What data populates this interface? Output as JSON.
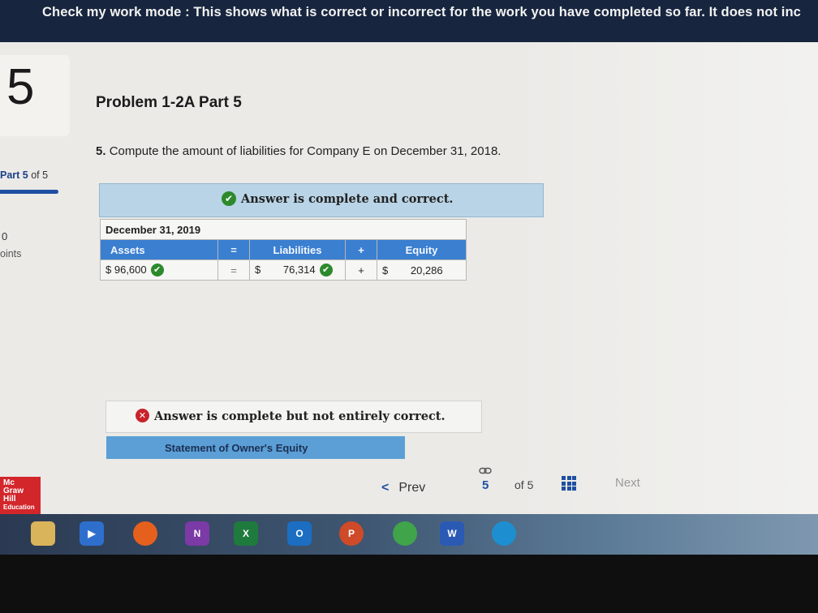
{
  "banner": {
    "text": "Check my work mode : This shows what is correct or incorrect for the work you have completed so far. It does not inc"
  },
  "sidebar": {
    "part_number": "5",
    "part_label": "Part 5",
    "of_label": "of 5",
    "points_value": "0",
    "points_label": "oints"
  },
  "problem": {
    "title": "Problem 1-2A Part 5",
    "question_number": "5.",
    "question_text": "Compute the amount of liabilities for Company E on December 31, 2018."
  },
  "result_banner": {
    "text": "Answer is complete and correct.",
    "icon": "check-circle-icon",
    "color": "#b9d4e6"
  },
  "equation_table": {
    "date": "December 31, 2019",
    "headers": {
      "assets": "Assets",
      "equals": "=",
      "liabilities": "Liabilities",
      "plus": "+",
      "equity": "Equity"
    },
    "row": {
      "assets_currency": "$",
      "assets_value": "96,600",
      "equals": "=",
      "liabilities_currency": "$",
      "liabilities_value": "76,314",
      "plus": "+",
      "equity_currency": "$",
      "equity_value": "20,286"
    },
    "header_color": "#3a7fd0"
  },
  "partial_banner": {
    "text": "Answer is complete but not entirely correct.",
    "icon": "x-circle-icon"
  },
  "statement_tab": {
    "label": "Statement of Owner's Equity"
  },
  "logo": {
    "line1": "Mc",
    "line2": "Graw",
    "line3": "Hill",
    "line4": "Education"
  },
  "pager": {
    "prev": "Prev",
    "current": "5",
    "of": "of 5",
    "next": "Next"
  },
  "taskbar": {
    "apps": [
      "file-explorer-icon",
      "video-app-icon",
      "firefox-icon",
      "onenote-icon",
      "excel-icon",
      "outlook-icon",
      "powerpoint-icon",
      "chrome-icon",
      "word-icon",
      "edge-icon"
    ],
    "onenote": "N",
    "excel": "X",
    "outlook": "O",
    "powerpoint": "P",
    "word": "W"
  }
}
